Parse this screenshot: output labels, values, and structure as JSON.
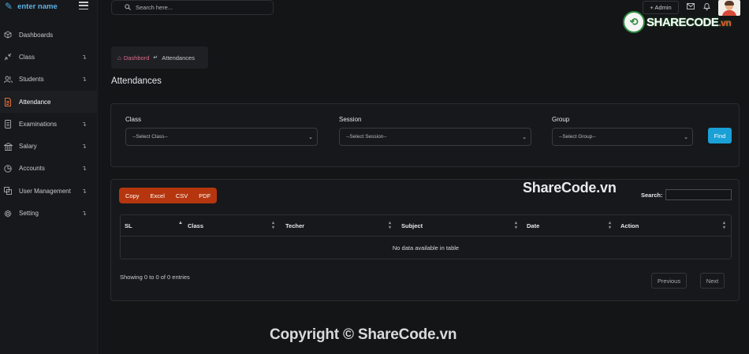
{
  "brand": {
    "name": "enter name"
  },
  "sidebar": {
    "items": [
      {
        "label": "Dashboards",
        "icon": "cube-icon",
        "arrow": false,
        "active": false
      },
      {
        "label": "Class",
        "icon": "shrink-icon",
        "arrow": true,
        "active": false
      },
      {
        "label": "Students",
        "icon": "users-icon",
        "arrow": true,
        "active": false
      },
      {
        "label": "Attendance",
        "icon": "document-icon",
        "arrow": false,
        "active": true
      },
      {
        "label": "Examinations",
        "icon": "file-icon",
        "arrow": true,
        "active": false
      },
      {
        "label": "Salary",
        "icon": "bank-icon",
        "arrow": true,
        "active": false
      },
      {
        "label": "Accounts",
        "icon": "pie-chart-icon",
        "arrow": true,
        "active": false
      },
      {
        "label": "User Management",
        "icon": "copy-icon",
        "arrow": true,
        "active": false
      },
      {
        "label": "Setting",
        "icon": "gear-icon",
        "arrow": true,
        "active": false
      }
    ]
  },
  "header": {
    "search_placeholder": "Search here...",
    "admin_label": "+ Admin"
  },
  "watermark": {
    "logo_text": "SHARECODE",
    "logo_domain": ".vn",
    "mid_text": "ShareCode.vn",
    "copyright": "Copyright © ShareCode.vn"
  },
  "breadcrumb": {
    "home": "Dashbord",
    "separator": "↵",
    "current": "Attendances"
  },
  "page": {
    "title": "Attendances"
  },
  "filters": {
    "class_label": "Class",
    "class_value": "--Select Class--",
    "session_label": "Session",
    "session_value": "--Select Session--",
    "group_label": "Group",
    "group_value": "--Select Group--",
    "find_label": "Find"
  },
  "table": {
    "export_buttons": [
      "Copy",
      "Excel",
      "CSV",
      "PDF"
    ],
    "search_label": "Search:",
    "columns": [
      "SL",
      "Class",
      "Techer",
      "Subject",
      "Date",
      "Action"
    ],
    "empty_message": "No data available in table",
    "info": "Showing 0 to 0 of 0 entries",
    "previous_label": "Previous",
    "next_label": "Next"
  },
  "colors": {
    "accent": "#1aa0d6",
    "export": "#b5360e",
    "active_icon": "#e2703a",
    "link": "#e06a8a"
  }
}
